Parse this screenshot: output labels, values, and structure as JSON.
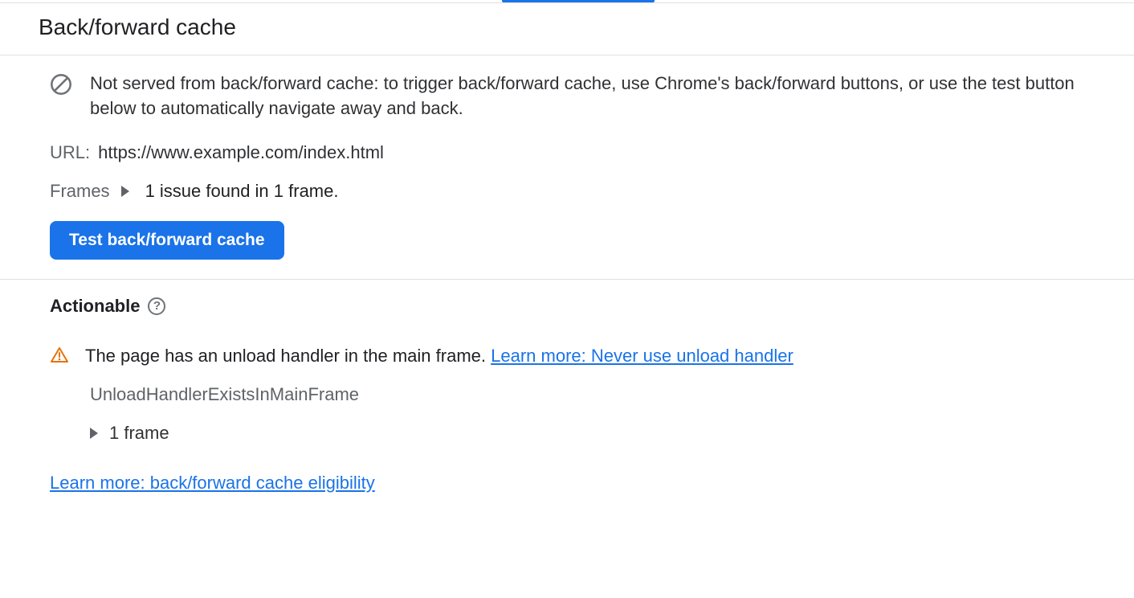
{
  "header": {
    "title": "Back/forward cache"
  },
  "status": {
    "message": "Not served from back/forward cache: to trigger back/forward cache, use Chrome's back/forward buttons, or use the test button below to automatically navigate away and back."
  },
  "url": {
    "label": "URL:",
    "value": "https://www.example.com/index.html"
  },
  "frames": {
    "label": "Frames",
    "summary": "1 issue found in 1 frame."
  },
  "testButton": {
    "label": "Test back/forward cache"
  },
  "actionable": {
    "title": "Actionable",
    "issue": {
      "text": "The page has an unload handler in the main frame.",
      "learnMoreLabel": "Learn more: Never use unload handler",
      "code": "UnloadHandlerExistsInMainFrame",
      "frameSummary": "1 frame"
    }
  },
  "learnMoreFooter": {
    "label": "Learn more: back/forward cache eligibility"
  }
}
